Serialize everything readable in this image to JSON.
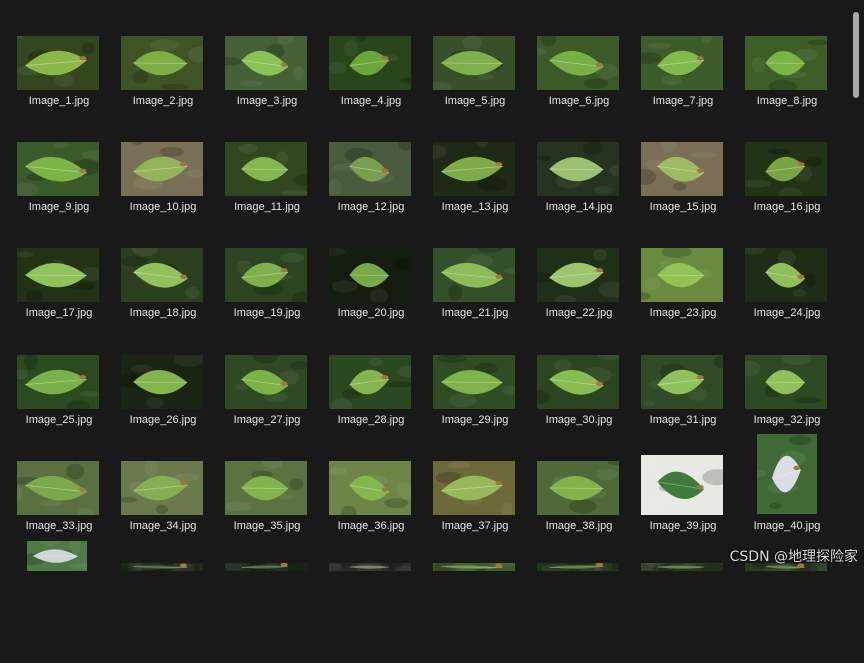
{
  "explorer": {
    "files": [
      {
        "name": "Image_1.jpg",
        "bg": "#33461e",
        "leaf": "#8cb84a"
      },
      {
        "name": "Image_2.jpg",
        "bg": "#3f5425",
        "leaf": "#7fae43"
      },
      {
        "name": "Image_3.jpg",
        "bg": "#466036",
        "leaf": "#8bc256"
      },
      {
        "name": "Image_4.jpg",
        "bg": "#28451b",
        "leaf": "#6aa63a"
      },
      {
        "name": "Image_5.jpg",
        "bg": "#37502a",
        "leaf": "#7fb14a"
      },
      {
        "name": "Image_6.jpg",
        "bg": "#3b5a27",
        "leaf": "#78b046"
      },
      {
        "name": "Image_7.jpg",
        "bg": "#3d5c2b",
        "leaf": "#82bb4c"
      },
      {
        "name": "Image_8.jpg",
        "bg": "#3d5e27",
        "leaf": "#7ab545"
      },
      {
        "name": "Image_9.jpg",
        "bg": "#3a5a2a",
        "leaf": "#7cb445"
      },
      {
        "name": "Image_10.jpg",
        "bg": "#7a7055",
        "leaf": "#93b458"
      },
      {
        "name": "Image_11.jpg",
        "bg": "#30471f",
        "leaf": "#85b750"
      },
      {
        "name": "Image_12.jpg",
        "bg": "#4a5a3c",
        "leaf": "#7a9e50"
      },
      {
        "name": "Image_13.jpg",
        "bg": "#1f2a16",
        "leaf": "#7eab47"
      },
      {
        "name": "Image_14.jpg",
        "bg": "#263320",
        "leaf": "#9bc070"
      },
      {
        "name": "Image_15.jpg",
        "bg": "#7c6e56",
        "leaf": "#9cbb63"
      },
      {
        "name": "Image_16.jpg",
        "bg": "#223318",
        "leaf": "#7aa444"
      },
      {
        "name": "Image_17.jpg",
        "bg": "#233217",
        "leaf": "#92c25a"
      },
      {
        "name": "Image_18.jpg",
        "bg": "#2c4020",
        "leaf": "#92c05a"
      },
      {
        "name": "Image_19.jpg",
        "bg": "#2c4520",
        "leaf": "#7fb04a"
      },
      {
        "name": "Image_20.jpg",
        "bg": "#141c10",
        "leaf": "#79a846"
      },
      {
        "name": "Image_21.jpg",
        "bg": "#33502a",
        "leaf": "#8cbc58"
      },
      {
        "name": "Image_22.jpg",
        "bg": "#203018",
        "leaf": "#9cc46c"
      },
      {
        "name": "Image_23.jpg",
        "bg": "#6a8a40",
        "leaf": "#93c355"
      },
      {
        "name": "Image_24.jpg",
        "bg": "#1f2d16",
        "leaf": "#90be58"
      },
      {
        "name": "Image_25.jpg",
        "bg": "#2b4a20",
        "leaf": "#79b048"
      },
      {
        "name": "Image_26.jpg",
        "bg": "#1a2412",
        "leaf": "#84b54c"
      },
      {
        "name": "Image_27.jpg",
        "bg": "#2f4a22",
        "leaf": "#7cb346"
      },
      {
        "name": "Image_28.jpg",
        "bg": "#2c4820",
        "leaf": "#84b64d"
      },
      {
        "name": "Image_29.jpg",
        "bg": "#2f4c22",
        "leaf": "#7eb44a"
      },
      {
        "name": "Image_30.jpg",
        "bg": "#2b4520",
        "leaf": "#88bb52"
      },
      {
        "name": "Image_31.jpg",
        "bg": "#2f4a24",
        "leaf": "#90c25c"
      },
      {
        "name": "Image_32.jpg",
        "bg": "#2e4a22",
        "leaf": "#8fc05a"
      },
      {
        "name": "Image_33.jpg",
        "bg": "#5a7040",
        "leaf": "#7aa84a"
      },
      {
        "name": "Image_34.jpg",
        "bg": "#6a7a4c",
        "leaf": "#86ad52"
      },
      {
        "name": "Image_35.jpg",
        "bg": "#5b7342",
        "leaf": "#82b44e"
      },
      {
        "name": "Image_36.jpg",
        "bg": "#6d8648",
        "leaf": "#86b650"
      },
      {
        "name": "Image_37.jpg",
        "bg": "#6d6a3a",
        "leaf": "#97b85a"
      },
      {
        "name": "Image_38.jpg",
        "bg": "#4f6a38",
        "leaf": "#83b24d"
      },
      {
        "name": "Image_39.jpg",
        "bg": "#e8e8e4",
        "leaf": "#3f7a3a"
      },
      {
        "name": "Image_40.jpg",
        "bg": "#3f6a38",
        "leaf": "#d9dde4"
      },
      {
        "name": "",
        "bg": "#4f7a45",
        "leaf": "#cfd6d8"
      },
      {
        "name": "",
        "bg": "#1e2a17",
        "leaf": "#3b5a2a"
      },
      {
        "name": "",
        "bg": "#1c2a16",
        "leaf": "#3a5a2a"
      },
      {
        "name": "",
        "bg": "#2a2a26",
        "leaf": "#6a6a62"
      },
      {
        "name": "",
        "bg": "#3d5a2c",
        "leaf": "#5e8a3e"
      },
      {
        "name": "",
        "bg": "#223418",
        "leaf": "#4a7030"
      },
      {
        "name": "",
        "bg": "#2a3a20",
        "leaf": "#4f7236"
      },
      {
        "name": "",
        "bg": "#2a3a20",
        "leaf": "#4f7236"
      }
    ]
  },
  "watermark": "CSDN @地理探险家"
}
